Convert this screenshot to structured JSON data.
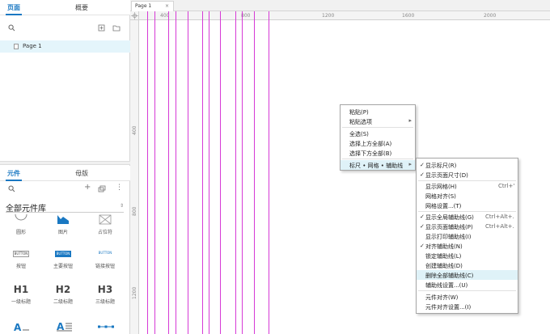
{
  "left_panel": {
    "pages_tabs": [
      "页面",
      "概要"
    ],
    "pages": [
      {
        "label": "Page 1"
      }
    ],
    "widget_tabs": [
      "元件",
      "母版"
    ],
    "library": "全部元件库",
    "widgets": [
      {
        "label": "圆形",
        "icon": "circle-icon"
      },
      {
        "label": "图片",
        "icon": "image-icon"
      },
      {
        "label": "占位符",
        "icon": "placeholder-icon"
      },
      {
        "label": "按钮",
        "glyph": "BUTTON",
        "icon": "button-icon"
      },
      {
        "label": "主要按钮",
        "glyph": "BUTTON",
        "icon": "primary-button-icon"
      },
      {
        "label": "链接按钮",
        "glyph": "BUTTON",
        "icon": "link-button-icon"
      },
      {
        "label": "一级标题",
        "glyph": "H1",
        "icon": "heading1-icon"
      },
      {
        "label": "二级标题",
        "glyph": "H2",
        "icon": "heading2-icon"
      },
      {
        "label": "三级标题",
        "glyph": "H3",
        "icon": "heading3-icon"
      }
    ]
  },
  "document": {
    "tab": "Page 1",
    "close": "×",
    "ruler_top": [
      "400",
      "800",
      "1200",
      "1600",
      "2000"
    ],
    "ruler_left": [
      "400",
      "800",
      "1200"
    ]
  },
  "menu1": {
    "items": [
      {
        "label": "粘贴(P)"
      },
      {
        "label": "粘贴选项",
        "submenu": true
      },
      {
        "label": "全选(S)"
      },
      {
        "label": "选择上方全部(A)"
      },
      {
        "label": "选择下方全部(B)"
      },
      {
        "label": "标尺 • 网格 • 辅助线",
        "submenu": true,
        "highlight": true
      }
    ]
  },
  "menu2": {
    "items": [
      {
        "label": "显示标尺(R)",
        "checked": true
      },
      {
        "label": "显示页面尺寸(D)",
        "checked": true
      },
      {
        "label": "显示网格(H)",
        "shortcut": "Ctrl+'"
      },
      {
        "label": "网格对齐(S)"
      },
      {
        "label": "网格设置...(T)"
      },
      {
        "label": "显示全局辅助线(G)",
        "checked": true,
        "shortcut": "Ctrl+Alt+."
      },
      {
        "label": "显示页面辅助线(P)",
        "checked": true,
        "shortcut": "Ctrl+Alt+."
      },
      {
        "label": "显示打印辅助线(I)"
      },
      {
        "label": "对齐辅助线(N)",
        "checked": true
      },
      {
        "label": "锁定辅助线(L)"
      },
      {
        "label": "创建辅助线(D)"
      },
      {
        "label": "删除全部辅助线(C)",
        "highlight": true
      },
      {
        "label": "辅助线设置...(U)"
      },
      {
        "label": "元件对齐(W)"
      },
      {
        "label": "元件对齐设置...(I)"
      }
    ]
  },
  "colors": {
    "accent": "#1a78c2",
    "guide": "#d63ad6",
    "highlight": "#dff2f8"
  }
}
